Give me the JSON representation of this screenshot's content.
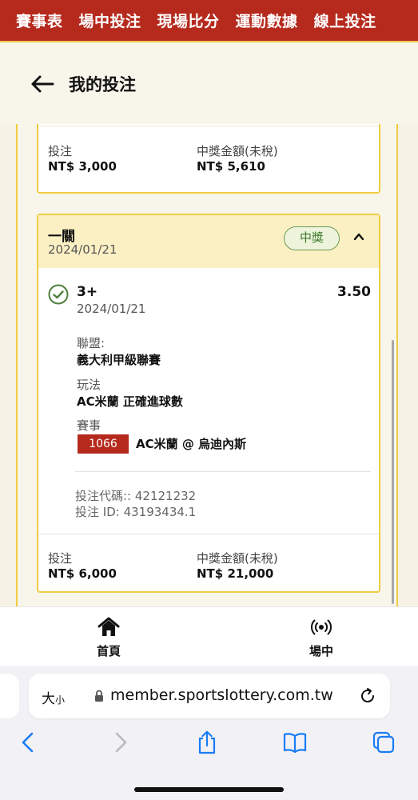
{
  "topnav": {
    "items": [
      "賽事表",
      "場中投注",
      "現場比分",
      "運動數據",
      "線上投注"
    ]
  },
  "header": {
    "title": "我的投注"
  },
  "prev_bet": {
    "stake_label": "投注",
    "stake_value": "NT$ 3,000",
    "payout_label": "中獎金額(未稅)",
    "payout_value": "NT$ 5,610"
  },
  "bet": {
    "type": "一關",
    "date": "2024/01/21",
    "status": "中獎",
    "selection": {
      "pick": "3+",
      "odds": "3.50",
      "date": "2024/01/21",
      "league_label": "聯盟:",
      "league_value": "義大利甲級聯賽",
      "market_label": "玩法",
      "market_value": "AC米蘭 正確進球數",
      "event_label": "賽事",
      "event_code": "1066",
      "event_name": "AC米蘭 @ 烏迪內斯"
    },
    "bet_code": "投注代碼:: 42121232",
    "bet_id": "投注 ID: 43193434.1",
    "stake_label": "投注",
    "stake_value": "NT$ 6,000",
    "payout_label": "中獎金額(未稅)",
    "payout_value": "NT$ 21,000"
  },
  "tabbar": {
    "home_label": "首頁",
    "live_label": "場中"
  },
  "browser": {
    "text_size_big": "大",
    "text_size_small": "小",
    "url": "member.sportslottery.com.tw"
  },
  "colors": {
    "brand_red": "#b52a1d",
    "accent_yellow": "#f0cc42",
    "win_green": "#3c7a2a",
    "ios_blue": "#1a7cf5"
  }
}
